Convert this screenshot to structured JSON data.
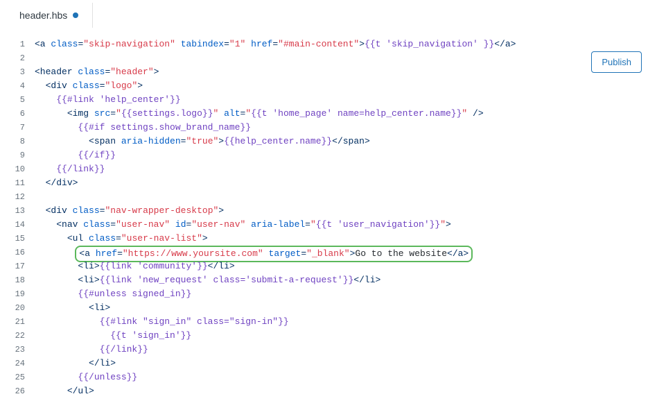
{
  "tab": {
    "filename": "header.hbs",
    "dirty": true
  },
  "buttons": {
    "publish": "Publish"
  },
  "gutter_start": 1,
  "gutter_end": 26,
  "code_lines": [
    {
      "n": 1,
      "tokens": [
        {
          "t": "tag",
          "v": "<a"
        },
        {
          "t": "txt",
          "v": " "
        },
        {
          "t": "attr-name",
          "v": "class"
        },
        {
          "t": "tag",
          "v": "="
        },
        {
          "t": "attr-val",
          "v": "\"skip-navigation\""
        },
        {
          "t": "txt",
          "v": " "
        },
        {
          "t": "attr-name",
          "v": "tabindex"
        },
        {
          "t": "tag",
          "v": "="
        },
        {
          "t": "attr-val",
          "v": "\"1\""
        },
        {
          "t": "txt",
          "v": " "
        },
        {
          "t": "attr-name",
          "v": "href"
        },
        {
          "t": "tag",
          "v": "="
        },
        {
          "t": "attr-val",
          "v": "\"#main-content\""
        },
        {
          "t": "tag",
          "v": ">"
        },
        {
          "t": "hbs",
          "v": "{{t 'skip_navigation' }}"
        },
        {
          "t": "tag",
          "v": "</a>"
        }
      ]
    },
    {
      "n": 2,
      "tokens": []
    },
    {
      "n": 3,
      "tokens": [
        {
          "t": "tag",
          "v": "<header"
        },
        {
          "t": "txt",
          "v": " "
        },
        {
          "t": "attr-name",
          "v": "class"
        },
        {
          "t": "tag",
          "v": "="
        },
        {
          "t": "attr-val",
          "v": "\"header\""
        },
        {
          "t": "tag",
          "v": ">"
        }
      ]
    },
    {
      "n": 4,
      "indent": 1,
      "tokens": [
        {
          "t": "tag",
          "v": "<div"
        },
        {
          "t": "txt",
          "v": " "
        },
        {
          "t": "attr-name",
          "v": "class"
        },
        {
          "t": "tag",
          "v": "="
        },
        {
          "t": "attr-val",
          "v": "\"logo\""
        },
        {
          "t": "tag",
          "v": ">"
        }
      ]
    },
    {
      "n": 5,
      "indent": 2,
      "tokens": [
        {
          "t": "hbs",
          "v": "{{#link 'help_center'}}"
        }
      ]
    },
    {
      "n": 6,
      "indent": 3,
      "tokens": [
        {
          "t": "tag",
          "v": "<img"
        },
        {
          "t": "txt",
          "v": " "
        },
        {
          "t": "attr-name",
          "v": "src"
        },
        {
          "t": "tag",
          "v": "="
        },
        {
          "t": "attr-val",
          "v": "\""
        },
        {
          "t": "hbs",
          "v": "{{settings.logo}}"
        },
        {
          "t": "attr-val",
          "v": "\""
        },
        {
          "t": "txt",
          "v": " "
        },
        {
          "t": "attr-name",
          "v": "alt"
        },
        {
          "t": "tag",
          "v": "="
        },
        {
          "t": "attr-val",
          "v": "\""
        },
        {
          "t": "hbs",
          "v": "{{t 'home_page' name=help_center.name}}"
        },
        {
          "t": "attr-val",
          "v": "\""
        },
        {
          "t": "txt",
          "v": " "
        },
        {
          "t": "tag",
          "v": "/>"
        }
      ]
    },
    {
      "n": 7,
      "indent": 4,
      "tokens": [
        {
          "t": "hbs",
          "v": "{{#if settings.show_brand_name}}"
        }
      ]
    },
    {
      "n": 8,
      "indent": 5,
      "tokens": [
        {
          "t": "tag",
          "v": "<span"
        },
        {
          "t": "txt",
          "v": " "
        },
        {
          "t": "attr-name",
          "v": "aria-hidden"
        },
        {
          "t": "tag",
          "v": "="
        },
        {
          "t": "attr-val",
          "v": "\"true\""
        },
        {
          "t": "tag",
          "v": ">"
        },
        {
          "t": "hbs",
          "v": "{{help_center.name}}"
        },
        {
          "t": "tag",
          "v": "</span>"
        }
      ]
    },
    {
      "n": 9,
      "indent": 4,
      "tokens": [
        {
          "t": "hbs",
          "v": "{{/if}}"
        }
      ]
    },
    {
      "n": 10,
      "indent": 2,
      "tokens": [
        {
          "t": "hbs",
          "v": "{{/link}}"
        }
      ]
    },
    {
      "n": 11,
      "indent": 1,
      "tokens": [
        {
          "t": "tag",
          "v": "</div>"
        }
      ]
    },
    {
      "n": 12,
      "tokens": []
    },
    {
      "n": 13,
      "indent": 1,
      "tokens": [
        {
          "t": "tag",
          "v": "<div"
        },
        {
          "t": "txt",
          "v": " "
        },
        {
          "t": "attr-name",
          "v": "class"
        },
        {
          "t": "tag",
          "v": "="
        },
        {
          "t": "attr-val",
          "v": "\"nav-wrapper-desktop\""
        },
        {
          "t": "tag",
          "v": ">"
        }
      ]
    },
    {
      "n": 14,
      "indent": 2,
      "tokens": [
        {
          "t": "tag",
          "v": "<nav"
        },
        {
          "t": "txt",
          "v": " "
        },
        {
          "t": "attr-name",
          "v": "class"
        },
        {
          "t": "tag",
          "v": "="
        },
        {
          "t": "attr-val",
          "v": "\"user-nav\""
        },
        {
          "t": "txt",
          "v": " "
        },
        {
          "t": "attr-name",
          "v": "id"
        },
        {
          "t": "tag",
          "v": "="
        },
        {
          "t": "attr-val",
          "v": "\"user-nav\""
        },
        {
          "t": "txt",
          "v": " "
        },
        {
          "t": "attr-name",
          "v": "aria-label"
        },
        {
          "t": "tag",
          "v": "="
        },
        {
          "t": "attr-val",
          "v": "\""
        },
        {
          "t": "hbs",
          "v": "{{t 'user_navigation'}}"
        },
        {
          "t": "attr-val",
          "v": "\""
        },
        {
          "t": "tag",
          "v": ">"
        }
      ]
    },
    {
      "n": 15,
      "indent": 3,
      "tokens": [
        {
          "t": "tag",
          "v": "<ul"
        },
        {
          "t": "txt",
          "v": " "
        },
        {
          "t": "attr-name",
          "v": "class"
        },
        {
          "t": "tag",
          "v": "="
        },
        {
          "t": "attr-val",
          "v": "\"user-nav-list\""
        },
        {
          "t": "tag",
          "v": ">"
        }
      ]
    },
    {
      "n": 16,
      "indent": 4,
      "highlight": true,
      "tokens": [
        {
          "t": "tag",
          "v": "<a"
        },
        {
          "t": "txt",
          "v": " "
        },
        {
          "t": "attr-name",
          "v": "href"
        },
        {
          "t": "tag",
          "v": "="
        },
        {
          "t": "attr-val",
          "v": "\"https://www.yoursite.com\""
        },
        {
          "t": "txt",
          "v": " "
        },
        {
          "t": "attr-name",
          "v": "target"
        },
        {
          "t": "tag",
          "v": "="
        },
        {
          "t": "attr-val",
          "v": "\"_blank\""
        },
        {
          "t": "tag",
          "v": ">"
        },
        {
          "t": "txt",
          "v": "Go to the website"
        },
        {
          "t": "tag",
          "v": "</a>"
        }
      ]
    },
    {
      "n": 17,
      "indent": 4,
      "tokens": [
        {
          "t": "tag",
          "v": "<li>"
        },
        {
          "t": "hbs",
          "v": "{{link 'community'}}"
        },
        {
          "t": "tag",
          "v": "</li>"
        }
      ]
    },
    {
      "n": 18,
      "indent": 4,
      "tokens": [
        {
          "t": "tag",
          "v": "<li>"
        },
        {
          "t": "hbs",
          "v": "{{link 'new_request' class='submit-a-request'}}"
        },
        {
          "t": "tag",
          "v": "</li>"
        }
      ]
    },
    {
      "n": 19,
      "indent": 4,
      "tokens": [
        {
          "t": "hbs",
          "v": "{{#unless signed_in}}"
        }
      ]
    },
    {
      "n": 20,
      "indent": 5,
      "tokens": [
        {
          "t": "tag",
          "v": "<li>"
        }
      ]
    },
    {
      "n": 21,
      "indent": 6,
      "tokens": [
        {
          "t": "hbs",
          "v": "{{#link \"sign_in\" class=\"sign-in\"}}"
        }
      ]
    },
    {
      "n": 22,
      "indent": 7,
      "tokens": [
        {
          "t": "hbs",
          "v": "{{t 'sign_in'}}"
        }
      ]
    },
    {
      "n": 23,
      "indent": 6,
      "tokens": [
        {
          "t": "hbs",
          "v": "{{/link}}"
        }
      ]
    },
    {
      "n": 24,
      "indent": 5,
      "tokens": [
        {
          "t": "tag",
          "v": "</li>"
        }
      ]
    },
    {
      "n": 25,
      "indent": 4,
      "tokens": [
        {
          "t": "hbs",
          "v": "{{/unless}}"
        }
      ]
    },
    {
      "n": 26,
      "indent": 3,
      "tokens": [
        {
          "t": "tag",
          "v": "</ul>"
        }
      ]
    }
  ]
}
